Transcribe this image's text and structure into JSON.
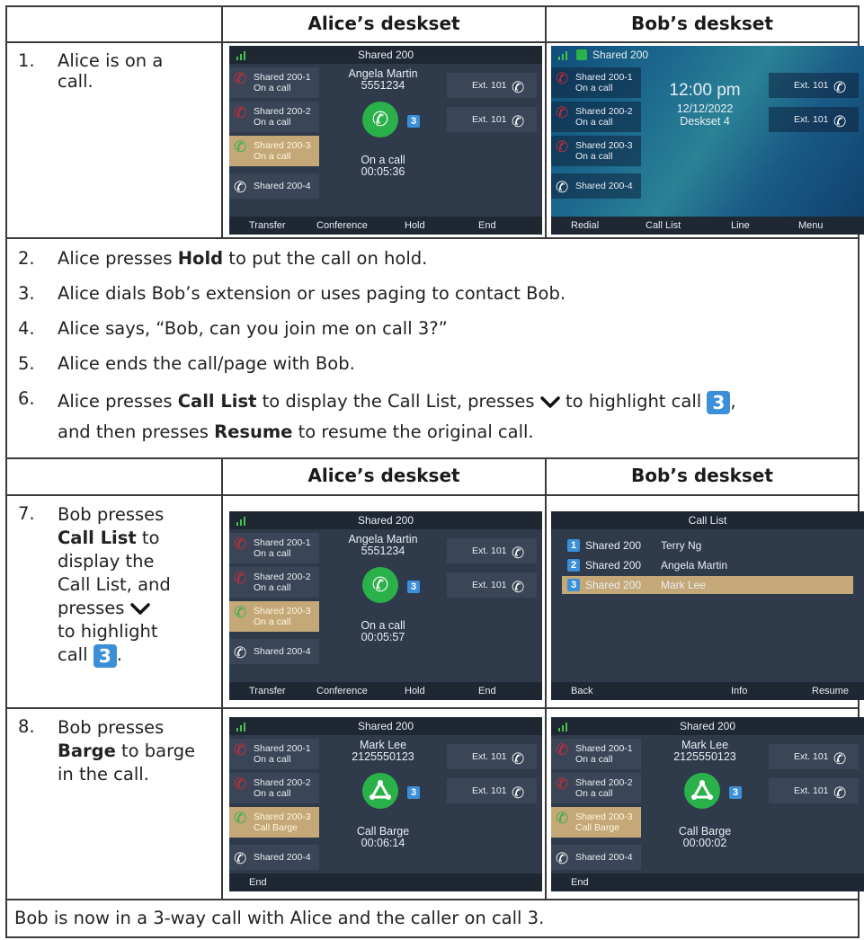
{
  "headers": {
    "alice": "Alice’s deskset",
    "bob": "Bob’s deskset"
  },
  "step1": {
    "num": "1.",
    "text": "Alice is on a call."
  },
  "steps_mid": [
    {
      "num": "2.",
      "pre": "Alice presses ",
      "bold": "Hold",
      "post": " to put the call on hold."
    },
    {
      "num": "3.",
      "text": "Alice dials Bob’s extension or uses paging to contact Bob."
    },
    {
      "num": "4.",
      "text": "Alice says, “Bob, can you join me on call 3?”"
    },
    {
      "num": "5.",
      "text": "Alice ends the call/page with Bob."
    }
  ],
  "step6": {
    "num": "6.",
    "a": "Alice presses ",
    "b": "Call List",
    "c": " to display the Call List, presses ",
    "d": " to highlight call ",
    "e": ",",
    "f": "and then presses ",
    "g": "Resume",
    "h": " to resume the original call.",
    "badge": "3"
  },
  "step7": {
    "num": "7.",
    "l1": "Bob presses",
    "l2": "Call List",
    "l2b": " to",
    "l3": "display the",
    "l4": "Call List, and",
    "l5": "presses ",
    "l6": "to highlight",
    "l7": "call ",
    "l7b": ".",
    "badge": "3"
  },
  "step8": {
    "num": "8.",
    "l1": "Bob presses",
    "l2": "Barge",
    "l2b": " to barge",
    "l3": "in the call."
  },
  "footer": "Bob is now in a 3-way call with Alice and the caller on call 3.",
  "phones": {
    "title": "Shared 200",
    "keys": [
      "Shared 200-1",
      "Shared 200-2",
      "Shared 200-3",
      "Shared 200-4"
    ],
    "on_call": "On a call",
    "call_barge": "Call Barge",
    "ext": "Ext. 101",
    "badge": "3",
    "p1": {
      "name": "Angela Martin",
      "number": "5551234",
      "status": "On a call",
      "timer": "00:05:36",
      "soft": [
        "Transfer",
        "Conference",
        "Hold",
        "End"
      ]
    },
    "p2": {
      "time": "12:00 pm",
      "date": "12/12/2022",
      "device": "Deskset 4",
      "soft": [
        "Redial",
        "Call List",
        "Line",
        "Menu"
      ]
    },
    "p3": {
      "name": "Angela Martin",
      "number": "5551234",
      "status": "On a call",
      "timer": "00:05:57",
      "soft": [
        "Transfer",
        "Conference",
        "Hold",
        "End"
      ]
    },
    "p4": {
      "title": "Call List",
      "rows": [
        {
          "n": "1",
          "line": "Shared 200",
          "name": "Terry Ng"
        },
        {
          "n": "2",
          "line": "Shared 200",
          "name": "Angela Martin"
        },
        {
          "n": "3",
          "line": "Shared 200",
          "name": "Mark Lee"
        }
      ],
      "soft": [
        "Back",
        "Info",
        "Resume"
      ]
    },
    "p5": {
      "name": "Mark Lee",
      "number": "2125550123",
      "status": "Call Barge",
      "timer": "00:06:14",
      "soft": [
        "End"
      ]
    },
    "p6": {
      "name": "Mark Lee",
      "number": "2125550123",
      "status": "Call Barge",
      "timer": "00:00:02",
      "soft": [
        "End"
      ]
    }
  },
  "colors": {
    "accent_green": "#2bb14a",
    "highlight": "#c4a877",
    "badge_blue": "#3a8fd8",
    "screen_bg": "#2f3a4b"
  }
}
